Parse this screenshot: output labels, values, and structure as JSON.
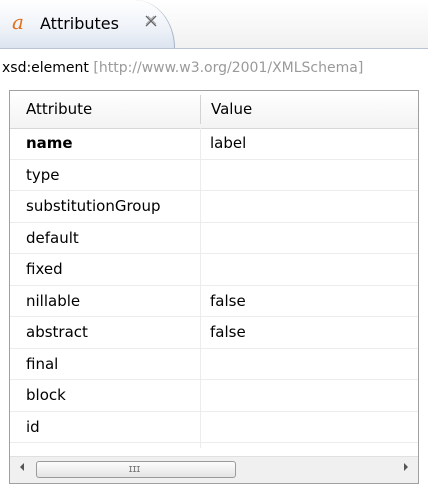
{
  "tab": {
    "icon": "attributes-a-icon",
    "label": "Attributes",
    "close_icon": "close-icon"
  },
  "path": {
    "element": "xsd:element",
    "namespace": "[http://www.w3.org/2001/XMLSchema]"
  },
  "table": {
    "headers": {
      "attribute": "Attribute",
      "value": "Value"
    },
    "rows": [
      {
        "name": "name",
        "value": "label",
        "bold": true
      },
      {
        "name": "type",
        "value": ""
      },
      {
        "name": "substitutionGroup",
        "value": ""
      },
      {
        "name": "default",
        "value": ""
      },
      {
        "name": "fixed",
        "value": ""
      },
      {
        "name": "nillable",
        "value": "false"
      },
      {
        "name": "abstract",
        "value": "false"
      },
      {
        "name": "final",
        "value": ""
      },
      {
        "name": "block",
        "value": ""
      },
      {
        "name": "id",
        "value": ""
      }
    ]
  },
  "scrollbar": {
    "left_arrow_icon": "scroll-left-arrow-icon",
    "right_arrow_icon": "scroll-right-arrow-icon",
    "grip": "III"
  },
  "colors": {
    "tab_icon": "#e0701a",
    "namespace_text": "#9a9a9a",
    "tab_border": "#a6b3c6"
  }
}
